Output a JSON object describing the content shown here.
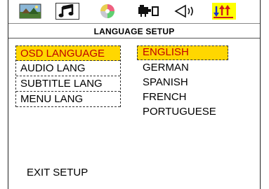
{
  "toolbar": {
    "icons": [
      {
        "name": "picture-icon"
      },
      {
        "name": "music-icon"
      },
      {
        "name": "disc-icon"
      },
      {
        "name": "video-camera-icon"
      },
      {
        "name": "speaker-icon"
      },
      {
        "name": "rating-icon"
      }
    ],
    "active_color": "#ffff00"
  },
  "header": {
    "title": "LANGUAGE SETUP"
  },
  "menu": {
    "items": [
      "OSD LANGUAGE",
      "AUDIO LANG",
      "SUBTITLE LANG",
      "MENU LANG"
    ],
    "selected_index": 0
  },
  "options": {
    "items": [
      "ENGLISH",
      "GERMAN",
      "SPANISH",
      "FRENCH",
      "PORTUGUESE"
    ],
    "selected_index": 0
  },
  "footer": {
    "exit_label": "EXIT SETUP"
  },
  "colors": {
    "highlight_bg": "#ffd700",
    "highlight_text": "#c00000"
  }
}
